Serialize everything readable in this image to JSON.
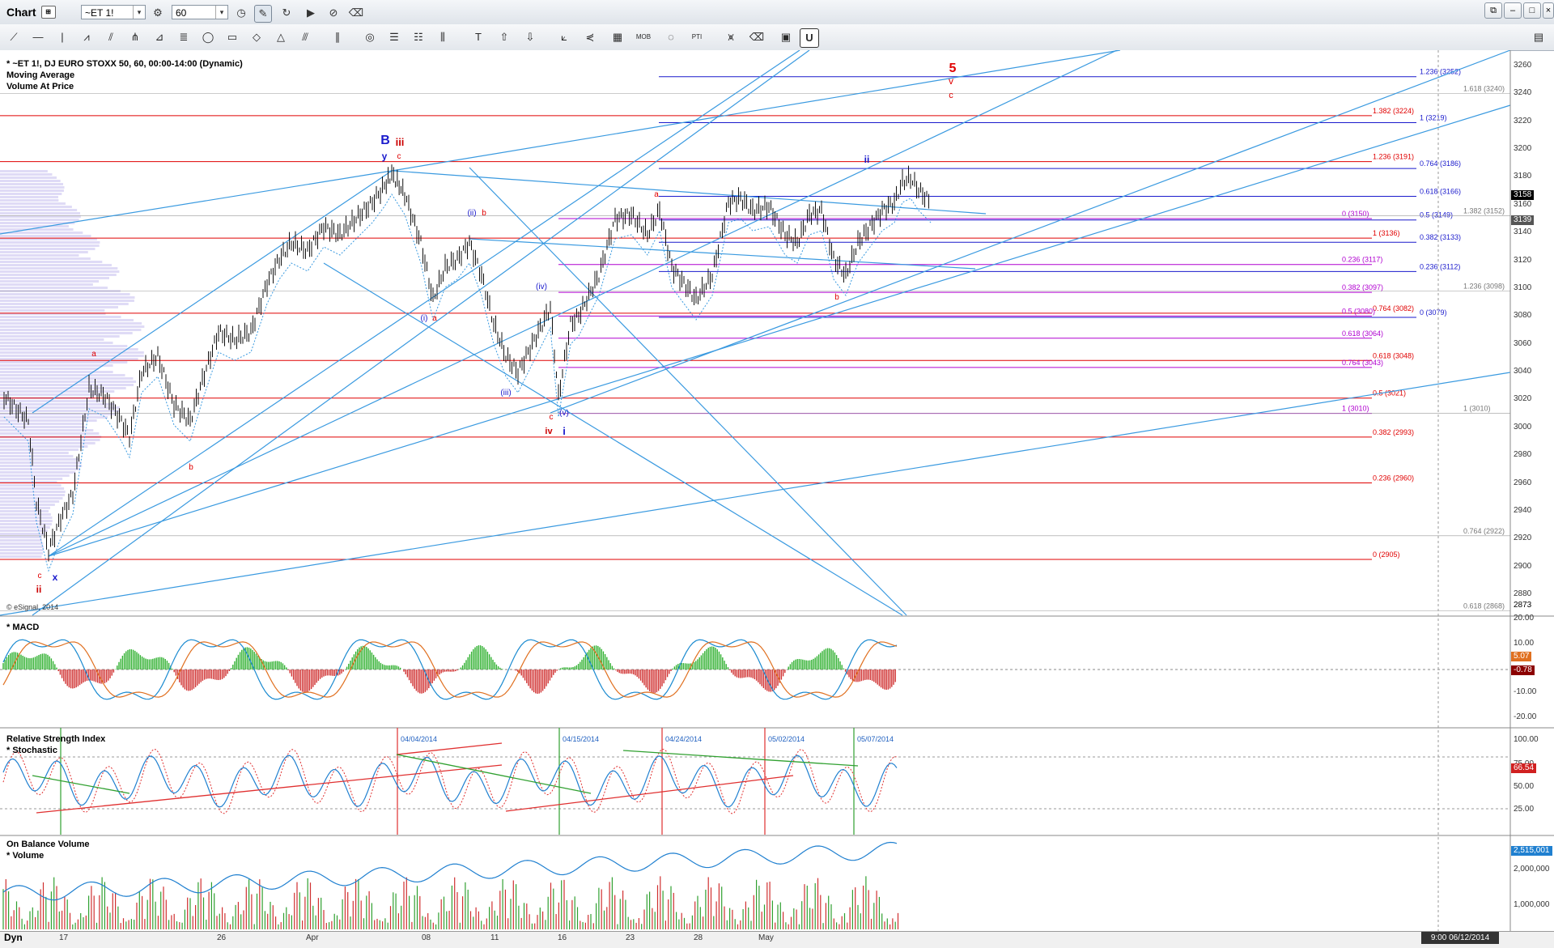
{
  "window": {
    "title": "Chart",
    "symbol": "~ET 1!",
    "interval": "60"
  },
  "panels": {
    "price": {
      "title": "* ~ET 1!, DJ EURO STOXX 50, 60, 00:00-14:00 (Dynamic)",
      "studies": [
        "Moving Average",
        "Volume At Price"
      ],
      "copyright": "© eSignal, 2014"
    },
    "macd": {
      "title": "* MACD"
    },
    "rsi": {
      "title": "Relative Strength Index",
      "subtitle": "* Stochastic"
    },
    "obv": {
      "title": "On Balance Volume",
      "subtitle": "* Volume"
    }
  },
  "price_axis": [
    "3260",
    "3240",
    "3220",
    "3200",
    "3180",
    "3160",
    "3140",
    "3120",
    "3100",
    "3080",
    "3060",
    "3040",
    "3020",
    "3000",
    "2980",
    "2960",
    "2940",
    "2920",
    "2900",
    "2880"
  ],
  "price_tags": {
    "last": "3158",
    "ma": "3139",
    "low": "2873"
  },
  "macd_axis": [
    "20.00",
    "10.00",
    "-10.00",
    "-20.00"
  ],
  "macd_tags": {
    "macd": "5.07",
    "hist": "-0.78"
  },
  "rsi_axis": [
    "100.00",
    "75.00",
    "50.00",
    "25.00"
  ],
  "rsi_tags": {
    "rsi": "66.54"
  },
  "obv_axis": [
    "2,000,000",
    "1,000,000"
  ],
  "obv_tags": {
    "obv": "2,515,001"
  },
  "x_axis": [
    "17",
    "26",
    "Apr",
    "08",
    "11",
    "16",
    "23",
    "28",
    "May"
  ],
  "date_readout": "9:00 06/12/2014",
  "footer_label": "Dyn",
  "fib_red": [
    {
      "label": "1.382 (3224)",
      "value": 3224
    },
    {
      "label": "1.236 (3191)",
      "value": 3191
    },
    {
      "label": "1 (3136)",
      "value": 3136
    },
    {
      "label": "0.764 (3082)",
      "value": 3082
    },
    {
      "label": "0.618 (3048)",
      "value": 3048
    },
    {
      "label": "0.5 (3021)",
      "value": 3021
    },
    {
      "label": "0.382 (2993)",
      "value": 2993
    },
    {
      "label": "0.236 (2960)",
      "value": 2960
    },
    {
      "label": "0 (2905)",
      "value": 2905
    }
  ],
  "fib_blue": [
    {
      "label": "1.236 (3252)",
      "value": 3252
    },
    {
      "label": "1 (3219)",
      "value": 3219
    },
    {
      "label": "0.764 (3186)",
      "value": 3186
    },
    {
      "label": "0.618 (3166)",
      "value": 3166
    },
    {
      "label": "0.5 (3149)",
      "value": 3149
    },
    {
      "label": "0.382 (3133)",
      "value": 3133
    },
    {
      "label": "0.236 (3112)",
      "value": 3112
    },
    {
      "label": "0 (3079)",
      "value": 3079
    }
  ],
  "fib_purple": [
    {
      "label": "0 (3150)",
      "value": 3150
    },
    {
      "label": "0.236 (3117)",
      "value": 3117
    },
    {
      "label": "0.382 (3097)",
      "value": 3097
    },
    {
      "label": "0.5 (3080)",
      "value": 3080
    },
    {
      "label": "0.618 (3064)",
      "value": 3064
    },
    {
      "label": "0.764 (3043)",
      "value": 3043
    },
    {
      "label": "1 (3010)",
      "value": 3010
    }
  ],
  "fib_grey": [
    {
      "label": "1.618 (3240)",
      "value": 3240
    },
    {
      "label": "1.382 (3152)",
      "value": 3152
    },
    {
      "label": "1.236 (3098)",
      "value": 3098
    },
    {
      "label": "1 (3010)",
      "value": 3010
    },
    {
      "label": "0.764 (2922)",
      "value": 2922
    },
    {
      "label": "0.618 (2868)",
      "value": 2868
    }
  ],
  "wave_labels": [
    {
      "text": "5",
      "color": "#e00000"
    },
    {
      "text": "v",
      "color": "#e00000"
    },
    {
      "text": "c",
      "color": "#e00000"
    },
    {
      "text": "B",
      "color": "#1a1acc"
    },
    {
      "text": "iii",
      "color": "#cc0000"
    },
    {
      "text": "y",
      "color": "#1a1acc"
    },
    {
      "text": "c",
      "color": "#e00000"
    },
    {
      "text": "ii",
      "color": "#1a1acc"
    },
    {
      "text": "a",
      "color": "#e00000"
    },
    {
      "text": "b",
      "color": "#e00000"
    },
    {
      "text": "(ii)",
      "color": "#1a1acc"
    },
    {
      "text": "b",
      "color": "#e00000"
    },
    {
      "text": "(i)",
      "color": "#1a1acc"
    },
    {
      "text": "a",
      "color": "#e00000"
    },
    {
      "text": "(iv)",
      "color": "#1a1acc"
    },
    {
      "text": "(iii)",
      "color": "#1a1acc"
    },
    {
      "text": "c",
      "color": "#e00000"
    },
    {
      "text": "(v)",
      "color": "#1a1acc"
    },
    {
      "text": "iv",
      "color": "#cc0000"
    },
    {
      "text": "i",
      "color": "#1a1acc"
    },
    {
      "text": "a",
      "color": "#e00000"
    },
    {
      "text": "b",
      "color": "#e00000"
    },
    {
      "text": "c",
      "color": "#e00000"
    },
    {
      "text": "x",
      "color": "#1a1acc"
    },
    {
      "text": "ii",
      "color": "#cc0000"
    }
  ],
  "rsi_markers": [
    "04/04/2014",
    "04/15/2014",
    "04/24/2014",
    "05/02/2014",
    "05/07/2014"
  ],
  "colors": {
    "fib_red": "#e00000",
    "fib_blue": "#1a1acc",
    "fib_purple": "#b000d0",
    "trend": "#3a9ae0",
    "macd_pos": "#30b030",
    "macd_neg": "#d03030"
  }
}
